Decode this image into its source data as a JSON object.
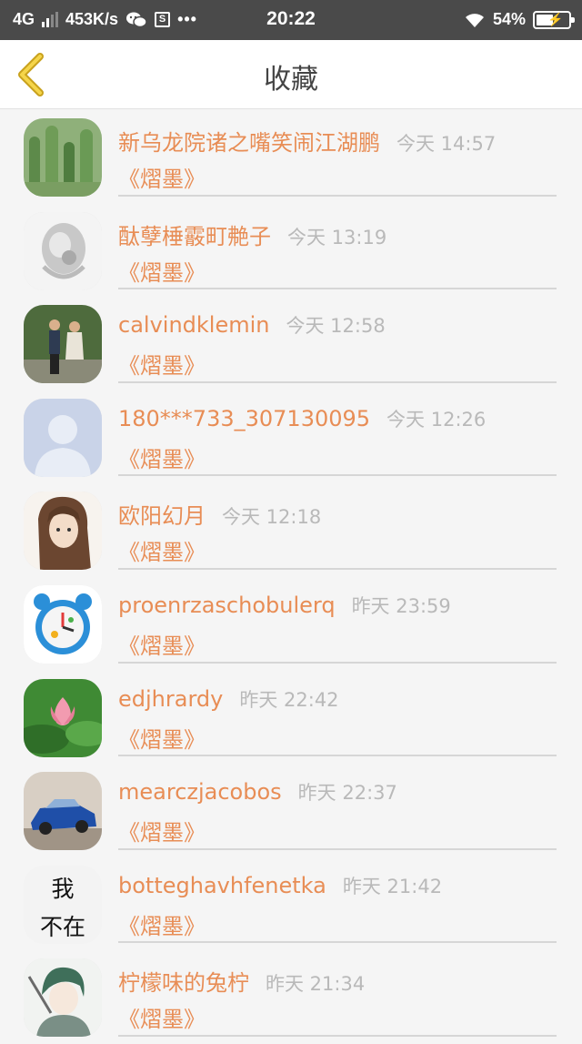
{
  "status_bar": {
    "network": "4G",
    "speed": "453K/s",
    "time": "20:22",
    "battery": "54%"
  },
  "header": {
    "title": "收藏"
  },
  "favorites": [
    {
      "name": "新乌龙院诸之嘴笑闹江湖鹏",
      "time": "今天 14:57",
      "book": "《熠墨》"
    },
    {
      "name": "酞孽棰霰町艴子",
      "time": "今天 13:19",
      "book": "《熠墨》"
    },
    {
      "name": "calvindklemin",
      "time": "今天 12:58",
      "book": "《熠墨》"
    },
    {
      "name": "180***733_307130095",
      "time": "今天 12:26",
      "book": "《熠墨》"
    },
    {
      "name": "欧阳幻月",
      "time": "今天 12:18",
      "book": "《熠墨》"
    },
    {
      "name": "proenrzaschobulerq",
      "time": "昨天 23:59",
      "book": "《熠墨》"
    },
    {
      "name": "edjhrardy",
      "time": "昨天 22:42",
      "book": "《熠墨》"
    },
    {
      "name": "mearczjacobos",
      "time": "昨天 22:37",
      "book": "《熠墨》"
    },
    {
      "name": "botteghavhfenetka",
      "time": "昨天 21:42",
      "book": "《熠墨》",
      "avatar_text": [
        "我",
        "不在"
      ]
    },
    {
      "name": "柠檬味的兔柠",
      "time": "昨天 21:34",
      "book": "《熠墨》"
    }
  ],
  "colors": {
    "accent": "#e88d55",
    "time_gray": "#b9b9b9",
    "back_arrow": "#e8c23a",
    "status_bar_bg": "#4a4a4a"
  }
}
